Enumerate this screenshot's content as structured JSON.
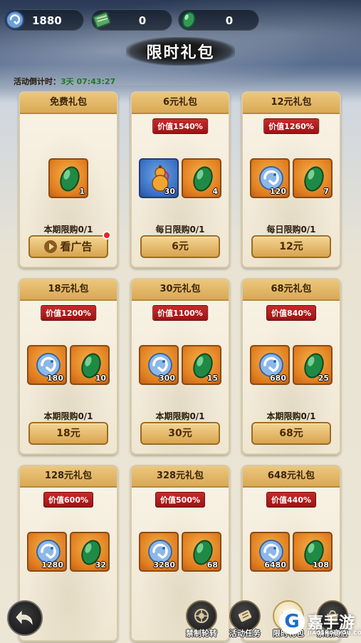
{
  "currency": [
    {
      "icon": "blue-dragon-icon",
      "value": "1880"
    },
    {
      "icon": "green-scroll-icon",
      "value": "0"
    },
    {
      "icon": "jade-gem-icon",
      "value": "0"
    }
  ],
  "title": "限时礼包",
  "countdown": {
    "label": "活动倒计时：",
    "time": "3天 07:43:27"
  },
  "packs": [
    {
      "name": "免费礼包",
      "value_tag": "",
      "items": [
        {
          "icon": "jade-gem-icon",
          "count": "1"
        }
      ],
      "limit": "本期限购0/1",
      "button": "看广告",
      "ad": true,
      "has_dot": true
    },
    {
      "name": "6元礼包",
      "value_tag": "价值1540%",
      "items": [
        {
          "icon": "gourd-icon",
          "count": "30",
          "bg": "blue"
        },
        {
          "icon": "jade-gem-icon",
          "count": "4"
        }
      ],
      "limit": "每日限购0/1",
      "button": "6元"
    },
    {
      "name": "12元礼包",
      "value_tag": "价值1260%",
      "items": [
        {
          "icon": "blue-dragon-icon",
          "count": "120"
        },
        {
          "icon": "jade-gem-icon",
          "count": "7"
        }
      ],
      "limit": "每日限购0/1",
      "button": "12元"
    },
    {
      "name": "18元礼包",
      "value_tag": "价值1200%",
      "items": [
        {
          "icon": "blue-dragon-icon",
          "count": "180"
        },
        {
          "icon": "jade-gem-icon",
          "count": "10"
        }
      ],
      "limit": "本期限购0/1",
      "button": "18元"
    },
    {
      "name": "30元礼包",
      "value_tag": "价值1100%",
      "items": [
        {
          "icon": "blue-dragon-icon",
          "count": "300"
        },
        {
          "icon": "jade-gem-icon",
          "count": "15"
        }
      ],
      "limit": "本期限购0/1",
      "button": "30元"
    },
    {
      "name": "68元礼包",
      "value_tag": "价值840%",
      "items": [
        {
          "icon": "blue-dragon-icon",
          "count": "680"
        },
        {
          "icon": "jade-gem-icon",
          "count": "25"
        }
      ],
      "limit": "本期限购0/1",
      "button": "68元"
    },
    {
      "name": "128元礼包",
      "value_tag": "价值600%",
      "items": [
        {
          "icon": "blue-dragon-icon",
          "count": "1280"
        },
        {
          "icon": "jade-gem-icon",
          "count": "32"
        }
      ],
      "limit": "",
      "button": ""
    },
    {
      "name": "328元礼包",
      "value_tag": "价值500%",
      "items": [
        {
          "icon": "blue-dragon-icon",
          "count": "3280"
        },
        {
          "icon": "jade-gem-icon",
          "count": "68"
        }
      ],
      "limit": "",
      "button": ""
    },
    {
      "name": "648元礼包",
      "value_tag": "价值440%",
      "items": [
        {
          "icon": "blue-dragon-icon",
          "count": "6480"
        },
        {
          "icon": "jade-gem-icon",
          "count": "108"
        }
      ],
      "limit": "",
      "button": ""
    }
  ],
  "bottom_nav": [
    {
      "label": "禁制轮转",
      "icon": "wheel-icon"
    },
    {
      "label": "活动任务",
      "icon": "scroll-icon"
    },
    {
      "label": "限时礼包",
      "icon": "gift-icon",
      "active": true
    },
    {
      "label": "禁制商店",
      "icon": "shop-icon"
    }
  ],
  "back_icon": "back-arrow-icon",
  "watermark": {
    "main": "嘉手游",
    "url": "JIAOSHOUYOU.COM"
  }
}
